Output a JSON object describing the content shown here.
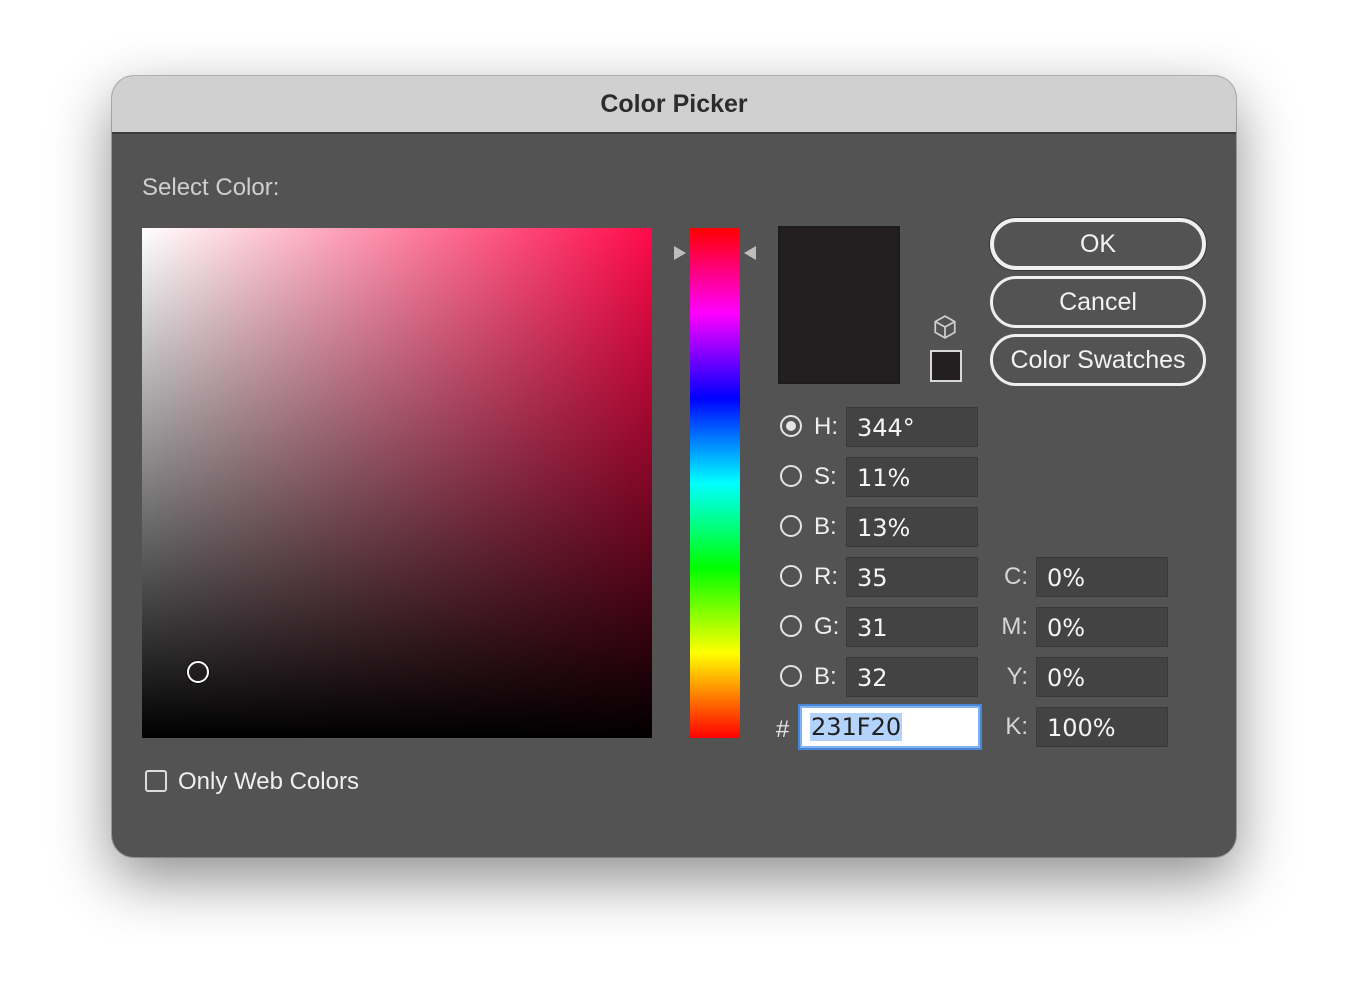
{
  "window": {
    "title": "Color Picker"
  },
  "picker": {
    "select_label": "Select Color:",
    "field_hue_color": "#ff0a4a",
    "cursor_saturation": 0.11,
    "cursor_brightness": 0.13
  },
  "swatch": {
    "new_color": "#231F20"
  },
  "buttons": {
    "ok": "OK",
    "cancel": "Cancel",
    "swatches": "Color Swatches"
  },
  "hsb": [
    {
      "key": "h",
      "label": "H:",
      "value": "344°",
      "selected": true
    },
    {
      "key": "s",
      "label": "S:",
      "value": "11%",
      "selected": false
    },
    {
      "key": "b",
      "label": "B:",
      "value": "13%",
      "selected": false
    }
  ],
  "rgb": [
    {
      "key": "r",
      "label": "R:",
      "value": "35",
      "selected": false
    },
    {
      "key": "g",
      "label": "G:",
      "value": "31",
      "selected": false
    },
    {
      "key": "b",
      "label": "B:",
      "value": "32",
      "selected": false
    }
  ],
  "cmyk": [
    {
      "label": "C:",
      "value": "0%"
    },
    {
      "label": "M:",
      "value": "0%"
    },
    {
      "label": "Y:",
      "value": "0%"
    },
    {
      "label": "K:",
      "value": "100%"
    }
  ],
  "hex": {
    "hash": "#",
    "value": "231F20"
  },
  "options": {
    "only_web_colors_label": "Only Web Colors",
    "only_web_colors_checked": false
  },
  "icons": {
    "gamut_warning": "cube-icon"
  }
}
